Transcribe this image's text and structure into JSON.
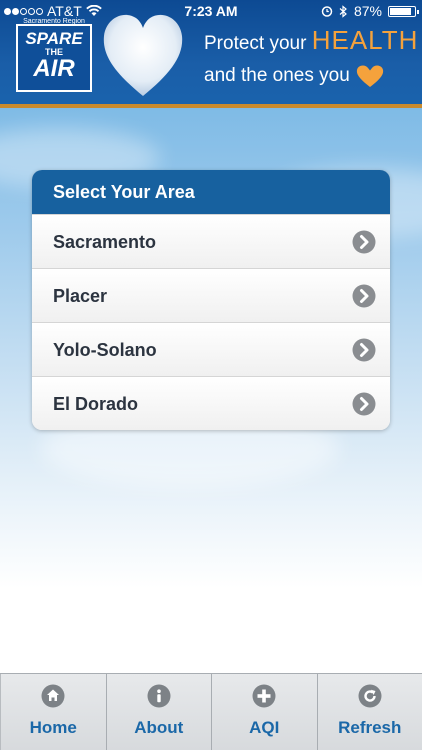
{
  "status_bar": {
    "carrier": "AT&T",
    "time": "7:23 AM",
    "battery_percent": "87%",
    "battery_level": 0.87,
    "signal_bars_filled": 2,
    "signal_bars_total": 5
  },
  "banner": {
    "logo": {
      "region": "Sacramento Region",
      "line1": "SPARE",
      "line2": "THE",
      "line3": "AIR"
    },
    "tagline_line1": "Protect your",
    "tagline_health": "HEALTH",
    "tagline_line2": "and the ones you",
    "heart_icon": "heart-icon",
    "accent_color": "#f5a23c"
  },
  "area_card": {
    "title": "Select Your Area",
    "header_color": "#17619f",
    "areas": [
      {
        "label": "Sacramento",
        "icon": "chevron-right-icon"
      },
      {
        "label": "Placer",
        "icon": "chevron-right-icon"
      },
      {
        "label": "Yolo-Solano",
        "icon": "chevron-right-icon"
      },
      {
        "label": "El Dorado",
        "icon": "chevron-right-icon"
      }
    ]
  },
  "tabbar": {
    "tabs": [
      {
        "label": "Home",
        "icon": "home-icon"
      },
      {
        "label": "About",
        "icon": "info-icon"
      },
      {
        "label": "AQI",
        "icon": "plus-icon"
      },
      {
        "label": "Refresh",
        "icon": "refresh-icon"
      }
    ],
    "label_color": "#1b68a8"
  }
}
